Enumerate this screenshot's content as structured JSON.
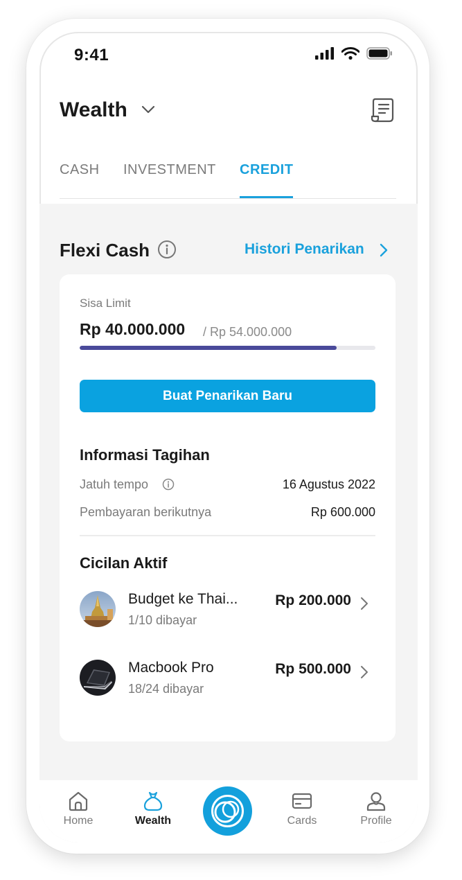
{
  "status_bar": {
    "time": "9:41"
  },
  "header": {
    "title": "Wealth"
  },
  "tabs": [
    {
      "label": "CASH"
    },
    {
      "label": "INVESTMENT"
    },
    {
      "label": "CREDIT"
    }
  ],
  "active_tab": "CREDIT",
  "flexi": {
    "title": "Flexi Cash",
    "history_link": "Histori Penarikan",
    "limit_label": "Sisa Limit",
    "limit_amount": "Rp 40.000.000",
    "limit_total": "/ Rp 54.000.000",
    "limit_remaining_fraction": 0.87,
    "withdraw_button": "Buat Penarikan Baru"
  },
  "billing": {
    "title": "Informasi Tagihan",
    "due_label": "Jatuh tempo",
    "due_value": "16 Agustus 2022",
    "next_payment_label": "Pembayaran berikutnya",
    "next_payment_value": "Rp 600.000"
  },
  "installments": {
    "title": "Cicilan Aktif",
    "items": [
      {
        "name": "Budget ke Thai...",
        "progress": "1/10 dibayar",
        "amount": "Rp 200.000",
        "icon": "temple-photo"
      },
      {
        "name": "Macbook Pro",
        "progress": "18/24 dibayar",
        "amount": "Rp 500.000",
        "icon": "laptop-photo"
      }
    ]
  },
  "nav": {
    "items": [
      {
        "label": "Home",
        "icon": "home-icon"
      },
      {
        "label": "Wealth",
        "icon": "money-bag-icon"
      },
      {
        "label": "Cards",
        "icon": "card-icon"
      },
      {
        "label": "Profile",
        "icon": "profile-icon"
      }
    ],
    "active": "Wealth"
  },
  "colors": {
    "accent": "#1aa1dc",
    "button": "#0aa2e0",
    "progress": "#4a4a9a",
    "background": "#f4f4f4"
  }
}
